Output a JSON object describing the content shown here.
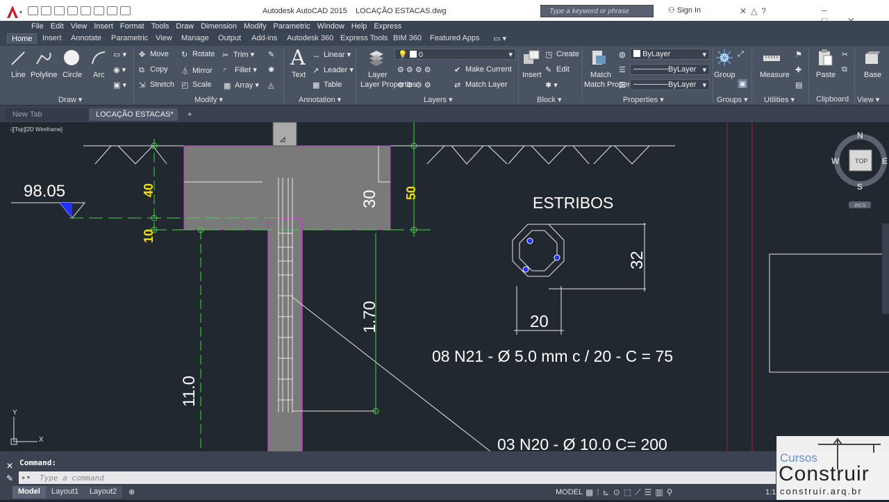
{
  "app": {
    "title": "Autodesk AutoCAD 2015",
    "document": "LOCAÇÃO ESTACAS.dwg",
    "search_placeholder": "Type a keyword or phrase",
    "signin": "Sign In"
  },
  "menu": [
    "File",
    "Edit",
    "View",
    "Insert",
    "Format",
    "Tools",
    "Draw",
    "Dimension",
    "Modify",
    "Parametric",
    "Window",
    "Help",
    "Express"
  ],
  "ribbon_tabs": [
    "Home",
    "Insert",
    "Annotate",
    "Parametric",
    "View",
    "Manage",
    "Output",
    "Add-ins",
    "Autodesk 360",
    "Express Tools",
    "BIM 360",
    "Featured Apps"
  ],
  "ribbon": {
    "draw": {
      "title": "Draw",
      "line": "Line",
      "polyline": "Polyline",
      "circle": "Circle",
      "arc": "Arc"
    },
    "modify": {
      "title": "Modify",
      "move": "Move",
      "rotate": "Rotate",
      "trim": "Trim",
      "copy": "Copy",
      "mirror": "Mirror",
      "fillet": "Fillet",
      "stretch": "Stretch",
      "scale": "Scale",
      "array": "Array"
    },
    "annotation": {
      "title": "Annotation",
      "text": "Text",
      "linear": "Linear",
      "leader": "Leader",
      "table": "Table"
    },
    "layers": {
      "title": "Layers",
      "layer_properties": "Layer Properties",
      "current_layer": "0",
      "make_current": "Make Current",
      "match_layer": "Match Layer"
    },
    "block": {
      "title": "Block",
      "insert": "Insert",
      "create": "Create",
      "edit": "Edit"
    },
    "properties": {
      "title": "Properties",
      "match_properties": "Match Properties",
      "color": "ByLayer",
      "linetype": "ByLayer",
      "lineweight": "ByLayer"
    },
    "groups": {
      "title": "Groups",
      "group": "Group"
    },
    "utilities": {
      "title": "Utilities",
      "measure": "Measure"
    },
    "clipboard": {
      "title": "Clipboard",
      "paste": "Paste"
    },
    "view": {
      "title": "View",
      "base": "Base"
    }
  },
  "file_tabs": {
    "new_tab": "New Tab",
    "active": "LOCAÇÃO ESTACAS*",
    "add": "+"
  },
  "viewport": {
    "label": "-][Top][2D Wireframe]",
    "viewcube": {
      "n": "N",
      "s": "S",
      "e": "E",
      "w": "W",
      "top": "TOP",
      "wcs": "WCS"
    },
    "ucs": {
      "x": "X",
      "y": "Y"
    }
  },
  "drawing": {
    "elevation": "98.05",
    "dim_40": "40",
    "dim_10": "10",
    "dim_30": "30",
    "dim_50": "50",
    "dim_170": "1.70",
    "dim_110": "11.0",
    "estribos_title": "ESTRIBOS",
    "dim_32": "32",
    "dim_20": "20",
    "estribos_spec": "08 N21 -  Ø 5.0 mm c / 20 - C = 75",
    "bar_spec": "03 N20 - Ø 10.0 C= 200"
  },
  "command": {
    "history": "Command:",
    "placeholder": "Type a command"
  },
  "layout_tabs": [
    "Model",
    "Layout1",
    "Layout2"
  ],
  "status": {
    "model": "MODEL",
    "scale": "1:1"
  },
  "watermark": {
    "line1": "Cursos",
    "line2": "Construir",
    "url": "construir.arq.br"
  }
}
